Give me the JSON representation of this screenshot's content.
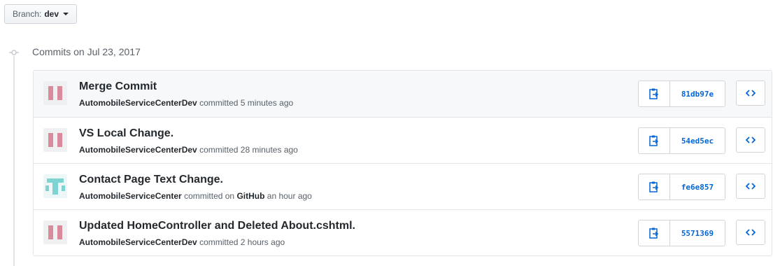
{
  "branch": {
    "label": "Branch:",
    "name": "dev"
  },
  "group": {
    "title": "Commits on Jul 23, 2017"
  },
  "colors": {
    "link": "#0366d6",
    "avatar_red": "#d98b9b",
    "avatar_teal": "#7fd3d3"
  },
  "commits": [
    {
      "message": "Merge Commit",
      "author": "AutomobileServiceCenterDev",
      "action": "committed",
      "via": "",
      "time": "5 minutes ago",
      "sha": "81db97e",
      "avatar": "red-bars"
    },
    {
      "message": "VS Local Change.",
      "author": "AutomobileServiceCenterDev",
      "action": "committed",
      "via": "",
      "time": "28 minutes ago",
      "sha": "54ed5ec",
      "avatar": "red-bars"
    },
    {
      "message": "Contact Page Text Change.",
      "author": "AutomobileServiceCenter",
      "action": "committed on",
      "via": "GitHub",
      "time": "an hour ago",
      "sha": "fe6e857",
      "avatar": "teal-t"
    },
    {
      "message": "Updated HomeController and Deleted About.cshtml.",
      "author": "AutomobileServiceCenterDev",
      "action": "committed",
      "via": "",
      "time": "2 hours ago",
      "sha": "5571369",
      "avatar": "red-bars"
    }
  ],
  "icons": {
    "copy": "clipboard-icon",
    "browse": "code-icon",
    "timeline": "commit-node-icon"
  }
}
